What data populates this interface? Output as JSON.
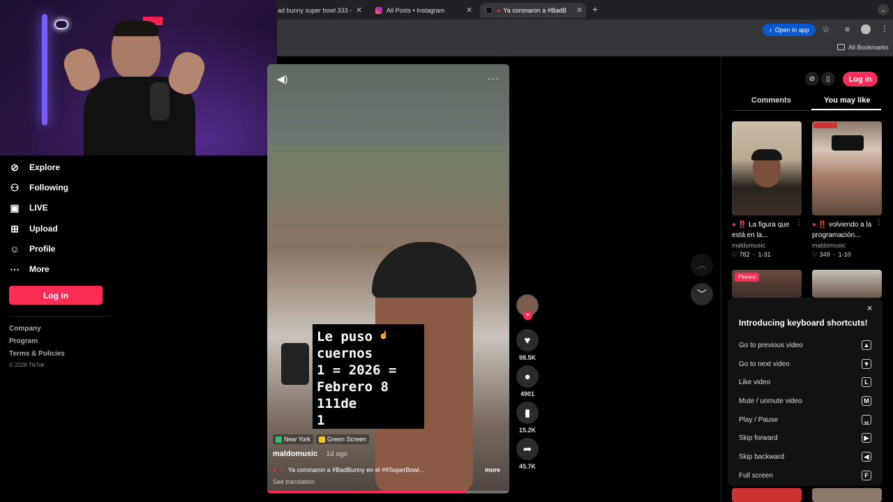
{
  "browser": {
    "tabs": [
      {
        "title": "ad bunny super bowl 333 -",
        "favicon": "tab-icon",
        "active": false
      },
      {
        "title": "All Posts • Instagram",
        "favicon": "instagram-icon",
        "active": false
      },
      {
        "title": "Ya coronaron a #BadB",
        "favicon": "tiktok-icon",
        "active": true
      }
    ],
    "open_in_app": "Open in app",
    "all_bookmarks": "All Bookmarks"
  },
  "sidebar": {
    "items": [
      {
        "label": "Explore",
        "icon": "compass-icon"
      },
      {
        "label": "Following",
        "icon": "user-follow-icon"
      },
      {
        "label": "LIVE",
        "icon": "live-icon"
      },
      {
        "label": "Upload",
        "icon": "plus-square-icon"
      },
      {
        "label": "Profile",
        "icon": "profile-icon"
      },
      {
        "label": "More",
        "icon": "more-icon"
      }
    ],
    "login": "Log in",
    "footer": [
      "Company",
      "Program",
      "Terms & Policies"
    ],
    "copyright": "© 2026 TikTok"
  },
  "video": {
    "overlay_text": "Le puso \ncuernos \n1 = 2026 =\nFebrero 8\n111de\n1",
    "location_chip": "New York",
    "effect_chip": "Green Screen",
    "username": "maldomusic",
    "age": "· 1d ago",
    "description": "Ya coronaron a #BadBunny en el ##SuperBowl...",
    "more": "more",
    "see_translation": "See translation",
    "progress": 0.82
  },
  "actions": {
    "likes": "98.5K",
    "comments": "4901",
    "saves": "15.2K",
    "shares": "45.7K"
  },
  "right_panel": {
    "login": "Log in",
    "tabs": [
      "Comments",
      "You may like"
    ],
    "active_tab": "You may like",
    "cards": [
      {
        "title": "‼️ La figura que está en la...",
        "user": "maldomusic",
        "likes": "782",
        "date": "1-31"
      },
      {
        "title": "‼️ volviendo a la programación...",
        "user": "maldomusic",
        "likes": "349",
        "date": "1-10"
      }
    ],
    "pinned": "Pinned"
  },
  "shortcuts": {
    "title": "Introducing keyboard shortcuts!",
    "rows": [
      {
        "label": "Go to previous video",
        "key": "▲"
      },
      {
        "label": "Go to next video",
        "key": "▼"
      },
      {
        "label": "Like video",
        "key": "L"
      },
      {
        "label": "Mute / unmute video",
        "key": "M"
      },
      {
        "label": "Play / Pause",
        "key": "␣"
      },
      {
        "label": "Skip forward",
        "key": "▶"
      },
      {
        "label": "Skip backward",
        "key": "◀"
      },
      {
        "label": "Full screen",
        "key": "F"
      }
    ]
  },
  "colors": {
    "accent": "#fe2c55"
  }
}
